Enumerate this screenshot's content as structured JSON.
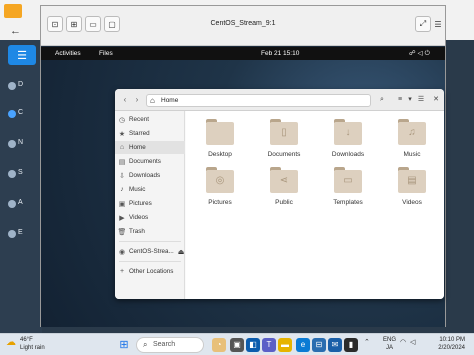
{
  "host": {
    "back_icon": "arrow-left-icon",
    "menu_icon": "hamburger-icon",
    "items": [
      {
        "label": "D"
      },
      {
        "label": "C"
      },
      {
        "label": "N"
      },
      {
        "label": "S"
      },
      {
        "label": "A"
      },
      {
        "label": "E"
      }
    ]
  },
  "vm": {
    "title": "CentOS_Stream_9:1",
    "toolbar_icons": [
      "screenshot-icon",
      "usb-icon",
      "keyboard-icon",
      "display-icon"
    ],
    "fullscreen_icon": "fullscreen-icon",
    "menu_icon": "menu-icon"
  },
  "gnome": {
    "activities": "Activities",
    "app_name": "Files",
    "clock": "Feb 21  15:10",
    "sys_icons": "network-icon volume-icon power-icon"
  },
  "files": {
    "path": "Home",
    "sidebar": [
      {
        "label": "Recent",
        "icon": "clock-icon"
      },
      {
        "label": "Starred",
        "icon": "star-icon"
      },
      {
        "label": "Home",
        "icon": "home-icon",
        "active": true
      },
      {
        "label": "Documents",
        "icon": "document-icon"
      },
      {
        "label": "Downloads",
        "icon": "download-icon"
      },
      {
        "label": "Music",
        "icon": "music-icon"
      },
      {
        "label": "Pictures",
        "icon": "picture-icon"
      },
      {
        "label": "Videos",
        "icon": "video-icon"
      },
      {
        "label": "Trash",
        "icon": "trash-icon"
      },
      {
        "label": "CentOS-Strea...",
        "icon": "disc-icon"
      },
      {
        "label": "Other Locations",
        "icon": "plus-icon"
      }
    ],
    "folders": [
      {
        "label": "Desktop",
        "icon": "folder-icon"
      },
      {
        "label": "Documents",
        "icon": "folder-document-icon"
      },
      {
        "label": "Downloads",
        "icon": "folder-download-icon"
      },
      {
        "label": "Music",
        "icon": "folder-music-icon"
      },
      {
        "label": "Pictures",
        "icon": "folder-camera-icon"
      },
      {
        "label": "Public",
        "icon": "folder-share-icon"
      },
      {
        "label": "Templates",
        "icon": "folder-template-icon"
      },
      {
        "label": "Videos",
        "icon": "folder-video-icon"
      }
    ]
  },
  "taskbar": {
    "weather_temp": "46°F",
    "weather_desc": "Light rain",
    "search_placeholder": "Search",
    "lang_line1": "ENG",
    "lang_line2": "JA",
    "time": "10:10 PM",
    "date": "2/20/2024"
  }
}
